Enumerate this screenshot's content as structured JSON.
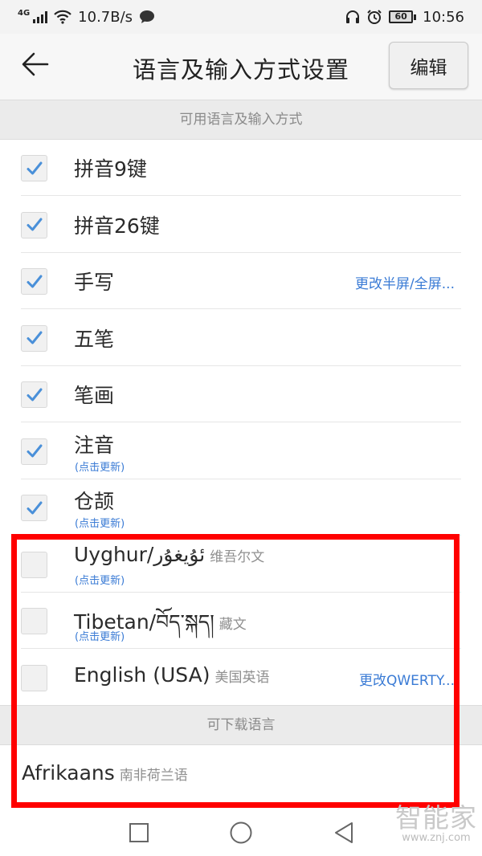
{
  "status_bar": {
    "network_type": "4G",
    "speed": "10.7B/s",
    "battery": "60",
    "time": "10:56"
  },
  "header": {
    "back_icon": "arrow-left-icon",
    "title": "语言及输入方式设置",
    "edit_label": "编辑"
  },
  "available_section": {
    "header": "可用语言及输入方式",
    "items": [
      {
        "label": "拼音9键",
        "checked": true,
        "update": "",
        "action": "",
        "sub": ""
      },
      {
        "label": "拼音26键",
        "checked": true,
        "update": "",
        "action": "",
        "sub": ""
      },
      {
        "label": "手写",
        "checked": true,
        "update": "",
        "action": "更改半屏/全屏...",
        "sub": ""
      },
      {
        "label": "五笔",
        "checked": true,
        "update": "",
        "action": "",
        "sub": ""
      },
      {
        "label": "笔画",
        "checked": true,
        "update": "",
        "action": "",
        "sub": ""
      },
      {
        "label": "注音",
        "checked": true,
        "update": "(点击更新)",
        "action": "",
        "sub": ""
      },
      {
        "label": "仓颉",
        "checked": true,
        "update": "(点击更新)",
        "action": "",
        "sub": ""
      },
      {
        "label": "Uyghur/ئۇيغۇر",
        "checked": false,
        "update": "(点击更新)",
        "action": "",
        "sub": "维吾尔文"
      },
      {
        "label": "Tibetan/བོད་སྐད།",
        "checked": false,
        "update": "(点击更新)",
        "action": "",
        "sub": "藏文"
      },
      {
        "label": "English (USA)",
        "checked": false,
        "update": "",
        "action": "更改QWERTY...",
        "sub": "美国英语"
      }
    ]
  },
  "download_section": {
    "header": "可下载语言",
    "items": [
      {
        "label": "Afrikaans",
        "sub": "南非荷兰语"
      }
    ]
  },
  "nav_bar": {
    "icons": [
      "recent-apps-icon",
      "home-icon",
      "back-triangle-icon"
    ]
  },
  "watermark": {
    "main": "智能家",
    "sub": "www.znj.com"
  },
  "colors": {
    "accent_blue": "#3a7bd5",
    "highlight_red": "#ff0000",
    "check_blue": "#4a90d9"
  }
}
